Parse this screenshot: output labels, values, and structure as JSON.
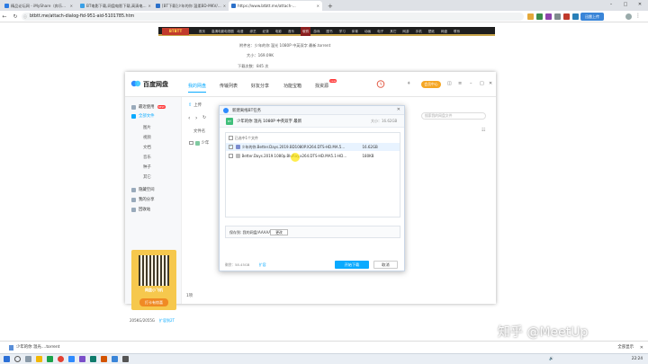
{
  "browser": {
    "tabs": [
      {
        "label": "精品论坛网 - iMyShare（奔乐...",
        "favicon_color": "#2a7ae2",
        "active": false
      },
      {
        "label": "BT电影下载,网盘电影下载,高清电...",
        "favicon_color": "#3aa0e6",
        "active": false
      },
      {
        "label": "[BT下载]少年的你 温柔BD-MKV/...",
        "favicon_color": "#2b70c9",
        "active": false
      },
      {
        "label": "https://www.btbtt.me/attach-...",
        "favicon_color": "#2b70c9",
        "active": true
      }
    ],
    "new_tab": "+",
    "address": "btbtt.me/attach-dialog-fid-951-aid-5101785.htm",
    "window_controls": {
      "minimize": "–",
      "maximize": "□",
      "close": "✕"
    },
    "extension_label": "迅雷上传"
  },
  "site": {
    "logo": "BTBTT",
    "nav": [
      "首页",
      "高清电影",
      "电视剧",
      "动漫",
      "综艺",
      "纪录",
      "电影",
      "音乐",
      "软件",
      "游戏",
      "图书",
      "学习",
      "体育",
      "动画",
      "电子",
      "其它",
      "网游",
      "手机",
      "壁纸",
      "网盘",
      "联系"
    ],
    "file_info": [
      {
        "label": "附件名：",
        "value": "少年的你 温光 1080P 中英双字 最新.torrent"
      },
      {
        "label": "大小：",
        "value": "169.09K"
      },
      {
        "label": "下载次数：",
        "value": "845 次"
      }
    ]
  },
  "netdisk": {
    "title": "百度网盘",
    "nav": [
      {
        "label": "我的网盘",
        "active": true
      },
      {
        "label": "传输列表",
        "active": false
      },
      {
        "label": "好友分享",
        "active": false
      },
      {
        "label": "功能宝箱",
        "active": false
      },
      {
        "label": "找资源",
        "active": false,
        "badge": "new"
      }
    ],
    "vip": "会员中心",
    "sidebar": [
      {
        "label": "最近使用",
        "badge": "NEW",
        "sub": false,
        "active": false
      },
      {
        "label": "全部文件",
        "sub": false,
        "active": true
      },
      {
        "label": "图片",
        "sub": true
      },
      {
        "label": "视频",
        "sub": true
      },
      {
        "label": "文档",
        "sub": true
      },
      {
        "label": "音乐",
        "sub": true
      },
      {
        "label": "种子",
        "sub": true
      },
      {
        "label": "其它",
        "sub": true
      },
      {
        "label": "隐藏空间",
        "sub": false
      },
      {
        "label": "我的分享",
        "sub": false
      },
      {
        "label": "回收站",
        "sub": false
      }
    ],
    "promo": {
      "line1": "网盘小飞机",
      "line2": "打卡有惊喜"
    },
    "quota": "205KG/2055G",
    "expand": "扩容到2T",
    "toolbar": {
      "upload": "上传"
    },
    "search_placeholder": "搜索我的网盘文件",
    "list": {
      "header": "文件名",
      "first_item": "少年"
    },
    "footer_count": "1项"
  },
  "dialog": {
    "title": "新建离线BT任务",
    "close": "✕",
    "torrent_name": "少年的你 温光 1080P 中英双字 最新",
    "torrent_size": "大小：16.62GB",
    "selected": "已选中1个文件",
    "files": [
      {
        "name": "少年的你.Better.Days.2019.BD1080P.X264.DTS-HD.MA.5...",
        "size": "16.62GB",
        "checked": true
      },
      {
        "name": "Better.Days.2019.1080p.BluRay.x264.DTS-HD.MA5.1-HD...",
        "size": "180KB",
        "checked": false
      }
    ],
    "save_to_label": "保存到: 我的网盘/AAAAAA",
    "change": "更改",
    "space_label": "剩余：",
    "space_value": "58.45GB",
    "expand": "扩容",
    "start": "开始下载",
    "cancel": "取消"
  },
  "download_bar": {
    "item": "少年的你 温光....torrent",
    "show_all": "全部显示"
  },
  "watermark": "知乎 @MeetUp",
  "taskbar": {
    "time": "22:24"
  }
}
